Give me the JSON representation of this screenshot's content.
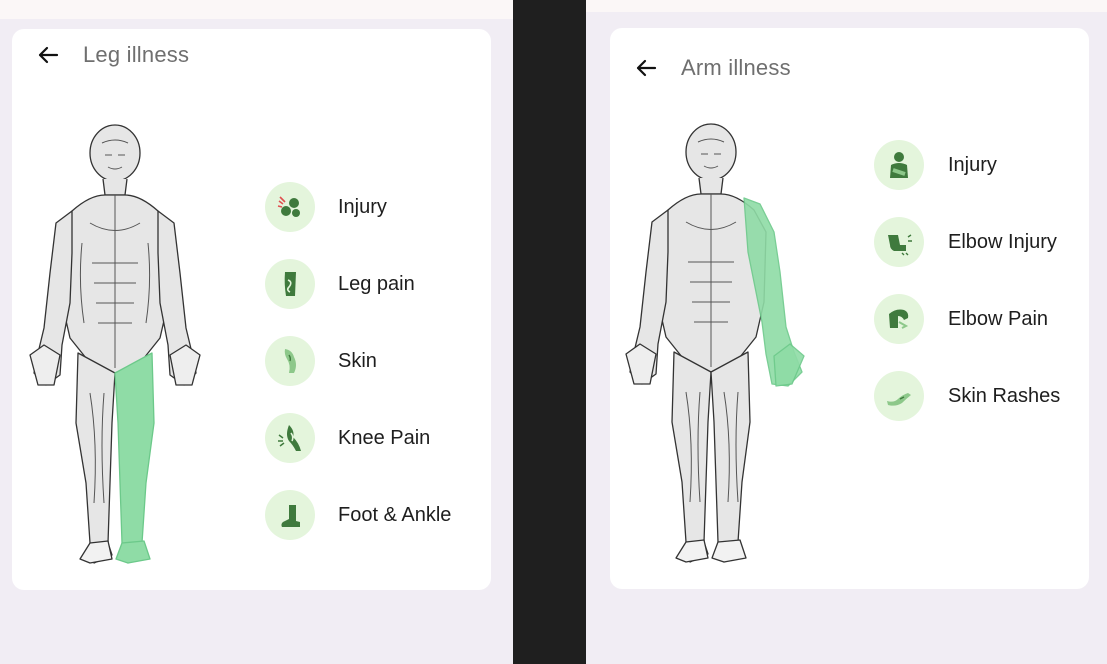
{
  "leg_screen": {
    "title": "Leg illness",
    "highlight_color": "#8fdca6",
    "items": [
      {
        "label": "Injury",
        "icon": "injury-icon"
      },
      {
        "label": "Leg pain",
        "icon": "leg-pain-icon"
      },
      {
        "label": "Skin",
        "icon": "skin-icon"
      },
      {
        "label": "Knee Pain",
        "icon": "knee-pain-icon"
      },
      {
        "label": "Foot & Ankle",
        "icon": "foot-ankle-icon"
      }
    ]
  },
  "arm_screen": {
    "title": "Arm illness",
    "highlight_color": "#8fdca6",
    "items": [
      {
        "label": "Injury",
        "icon": "arm-injury-icon"
      },
      {
        "label": "Elbow Injury",
        "icon": "elbow-injury-icon"
      },
      {
        "label": "Elbow Pain",
        "icon": "elbow-pain-icon"
      },
      {
        "label": "Skin Rashes",
        "icon": "skin-rashes-icon"
      }
    ]
  },
  "colors": {
    "background": "#f1edf4",
    "card": "#ffffff",
    "icon_bg": "#e4f5dc",
    "icon_fg": "#3f7a3d",
    "divider": "#1f1f1f"
  }
}
